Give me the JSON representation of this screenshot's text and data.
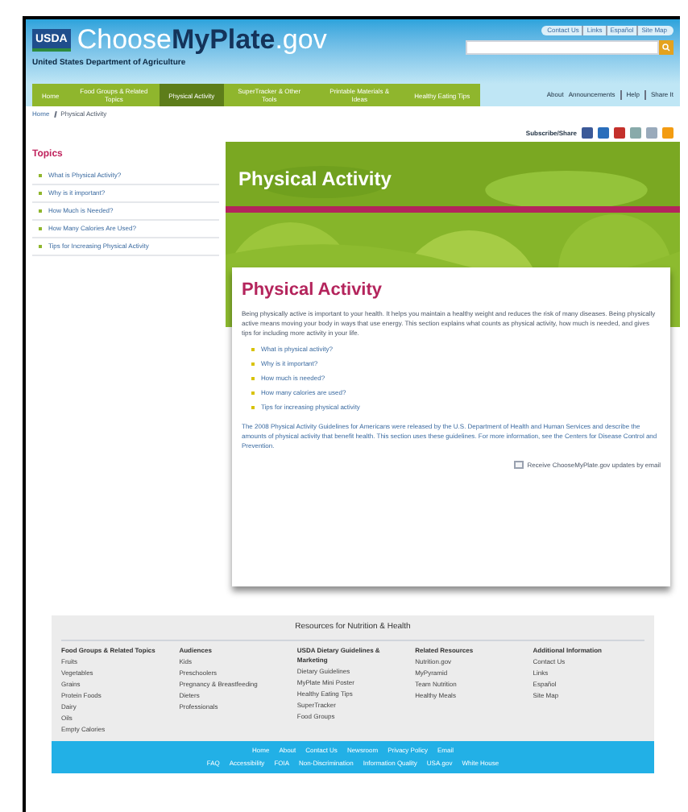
{
  "header": {
    "logo_mark": "USDA",
    "site_name_prefix": "Choose",
    "site_name_bold": "MyPlate",
    "site_name_suffix": ".gov",
    "department": "United States Department of Agriculture",
    "top_links": [
      "Contact Us",
      "Links",
      "Español",
      "Site Map"
    ],
    "util_links": [
      "About",
      "Announcements",
      "Help",
      "Share It"
    ]
  },
  "nav": [
    {
      "label": "Home",
      "selected": false
    },
    {
      "label": "Food Groups & Related Topics",
      "selected": false
    },
    {
      "label": "Physical Activity",
      "selected": true
    },
    {
      "label": "SuperTracker & Other Tools",
      "selected": false
    },
    {
      "label": "Printable Materials & Ideas",
      "selected": false
    },
    {
      "label": "Healthy Eating Tips",
      "selected": false
    }
  ],
  "breadcrumb": [
    "Home",
    "Physical Activity"
  ],
  "share_label": "Subscribe/Share",
  "sidebar": {
    "title": "Topics",
    "items": [
      "What is Physical Activity?",
      "Why is it important?",
      "How Much is Needed?",
      "How Many Calories Are Used?",
      "Tips for Increasing Physical Activity"
    ]
  },
  "hero": {
    "kind": "picture",
    "title": "Physical Activity"
  },
  "content": {
    "title": "Physical Activity",
    "intro": "Being physically active is important to your health. It helps you maintain a healthy weight and reduces the risk of many diseases. Being physically active means moving your body in ways that use energy. This section explains what counts as physical activity, how much is needed, and gives tips for including more activity in your life.",
    "links": [
      "What is physical activity?",
      "Why is it important?",
      "How much is needed?",
      "How many calories are used?",
      "Tips for increasing physical activity"
    ],
    "note": "The 2008 Physical Activity Guidelines for Americans were released by the U.S. Department of Health and Human Services and describe the amounts of physical activity that benefit health. This section uses these guidelines. For more information, see the Centers for Disease Control and Prevention.",
    "subscribe": "Receive ChooseMyPlate.gov updates by email"
  },
  "footer": {
    "title": "Resources for Nutrition & Health",
    "columns": [
      {
        "heading": "Food Groups & Related Topics",
        "items": [
          "Fruits",
          "Vegetables",
          "Grains",
          "Protein Foods",
          "Dairy",
          "Oils",
          "Empty Calories"
        ]
      },
      {
        "heading": "Audiences",
        "items": [
          "Kids",
          "Preschoolers",
          "Pregnancy & Breastfeeding",
          "Dieters",
          "Professionals"
        ]
      },
      {
        "heading": "USDA Dietary Guidelines & Marketing",
        "items": [
          "Dietary Guidelines",
          "MyPlate Mini Poster",
          "Healthy Eating Tips",
          "SuperTracker",
          "Food Groups"
        ]
      },
      {
        "heading": "Related Resources",
        "items": [
          "Nutrition.gov",
          "MyPyramid",
          "Team Nutrition",
          "Healthy Meals"
        ]
      },
      {
        "heading": "Additional Information",
        "items": [
          "Contact Us",
          "Links",
          "Español",
          "Site Map"
        ]
      }
    ],
    "bottom_links_1": [
      "Home",
      "About",
      "Contact Us",
      "Newsroom",
      "Privacy Policy",
      "Email"
    ],
    "bottom_links_2": [
      "FAQ",
      "Accessibility",
      "FOIA",
      "Non-Discrimination",
      "Information Quality",
      "USA.gov",
      "White House"
    ]
  }
}
